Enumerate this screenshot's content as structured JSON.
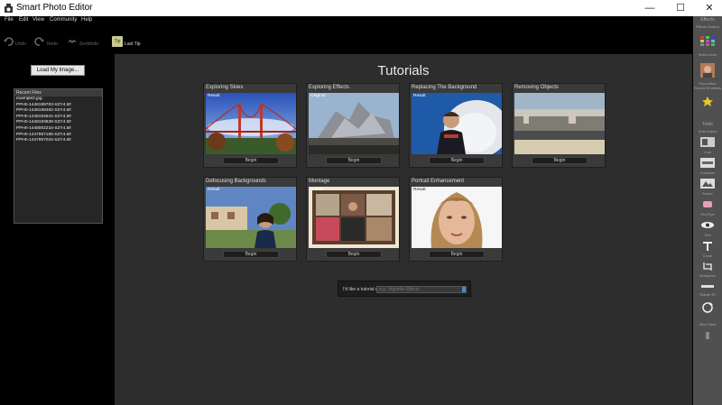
{
  "window": {
    "title": "Smart Photo Editor",
    "minimize_glyph": "—",
    "maximize_glyph": "☐",
    "close_glyph": "✕"
  },
  "menu": [
    "File",
    "Edit",
    "View",
    "Community",
    "Help"
  ],
  "toolbar": {
    "undo": "Undo",
    "redo": "Redo",
    "bird": "ZenMode",
    "last_tip": "Last Tip",
    "last_tip_icon": "Tip"
  },
  "left": {
    "load_button": "Load My Image...",
    "recent_header": "Recent Files",
    "recent_files": [
      "example2.jpg",
      "PPHh-1448199783-SZY4.tiff",
      "PPHh-1448198482-SZY4.tiff",
      "PPHh-1448194841-SZY4.tiff",
      "PPHh-1448193638-SZY4.tiff",
      "PPHh-1448002215-SZY4.tiff",
      "PPHh-1447957185-SZY4.tiff",
      "PPHh-1447957024-SZY4.tiff"
    ]
  },
  "main": {
    "title": "Tutorials",
    "tutorials": [
      {
        "title": "Exploring Skies",
        "result": "Result",
        "begin": "Begin"
      },
      {
        "title": "Exploring Effects",
        "result": "Original",
        "begin": "Begin"
      },
      {
        "title": "Replacing The Background",
        "result": "Result",
        "begin": "Begin"
      },
      {
        "title": "Removing Objects",
        "result": "",
        "begin": "Begin"
      },
      {
        "title": "Defocusing Backgrounds",
        "result": "Result",
        "begin": "Begin"
      },
      {
        "title": "Montage",
        "result": "Result",
        "begin": "Begin"
      },
      {
        "title": "Portrait Enhancement",
        "result": "Result",
        "begin": "Begin"
      }
    ],
    "tutorial_search_label": "I'd like a tutorial on:",
    "tutorial_search_placeholder": "e.g. Vignette Effects"
  },
  "right_sidebar": {
    "effects_label": "Effects",
    "effects_gallery": "Effects Gallery",
    "select_area": "Select Area",
    "favourites": "Favourites Recent Shortlists",
    "tools_label": "Tools",
    "tools": [
      "Auto Adjust",
      "Crop",
      "Enhance",
      "Eraser",
      "Red Eye",
      "Text",
      "Clone",
      "Straighten",
      "Rotate 90"
    ],
    "after_edits": "After Edits"
  },
  "colors": {
    "main_bg": "#2d2d2d",
    "card_bg": "#3a3a3a",
    "sidebar_bg": "#505050",
    "accent_blue": "#4a86c8"
  }
}
